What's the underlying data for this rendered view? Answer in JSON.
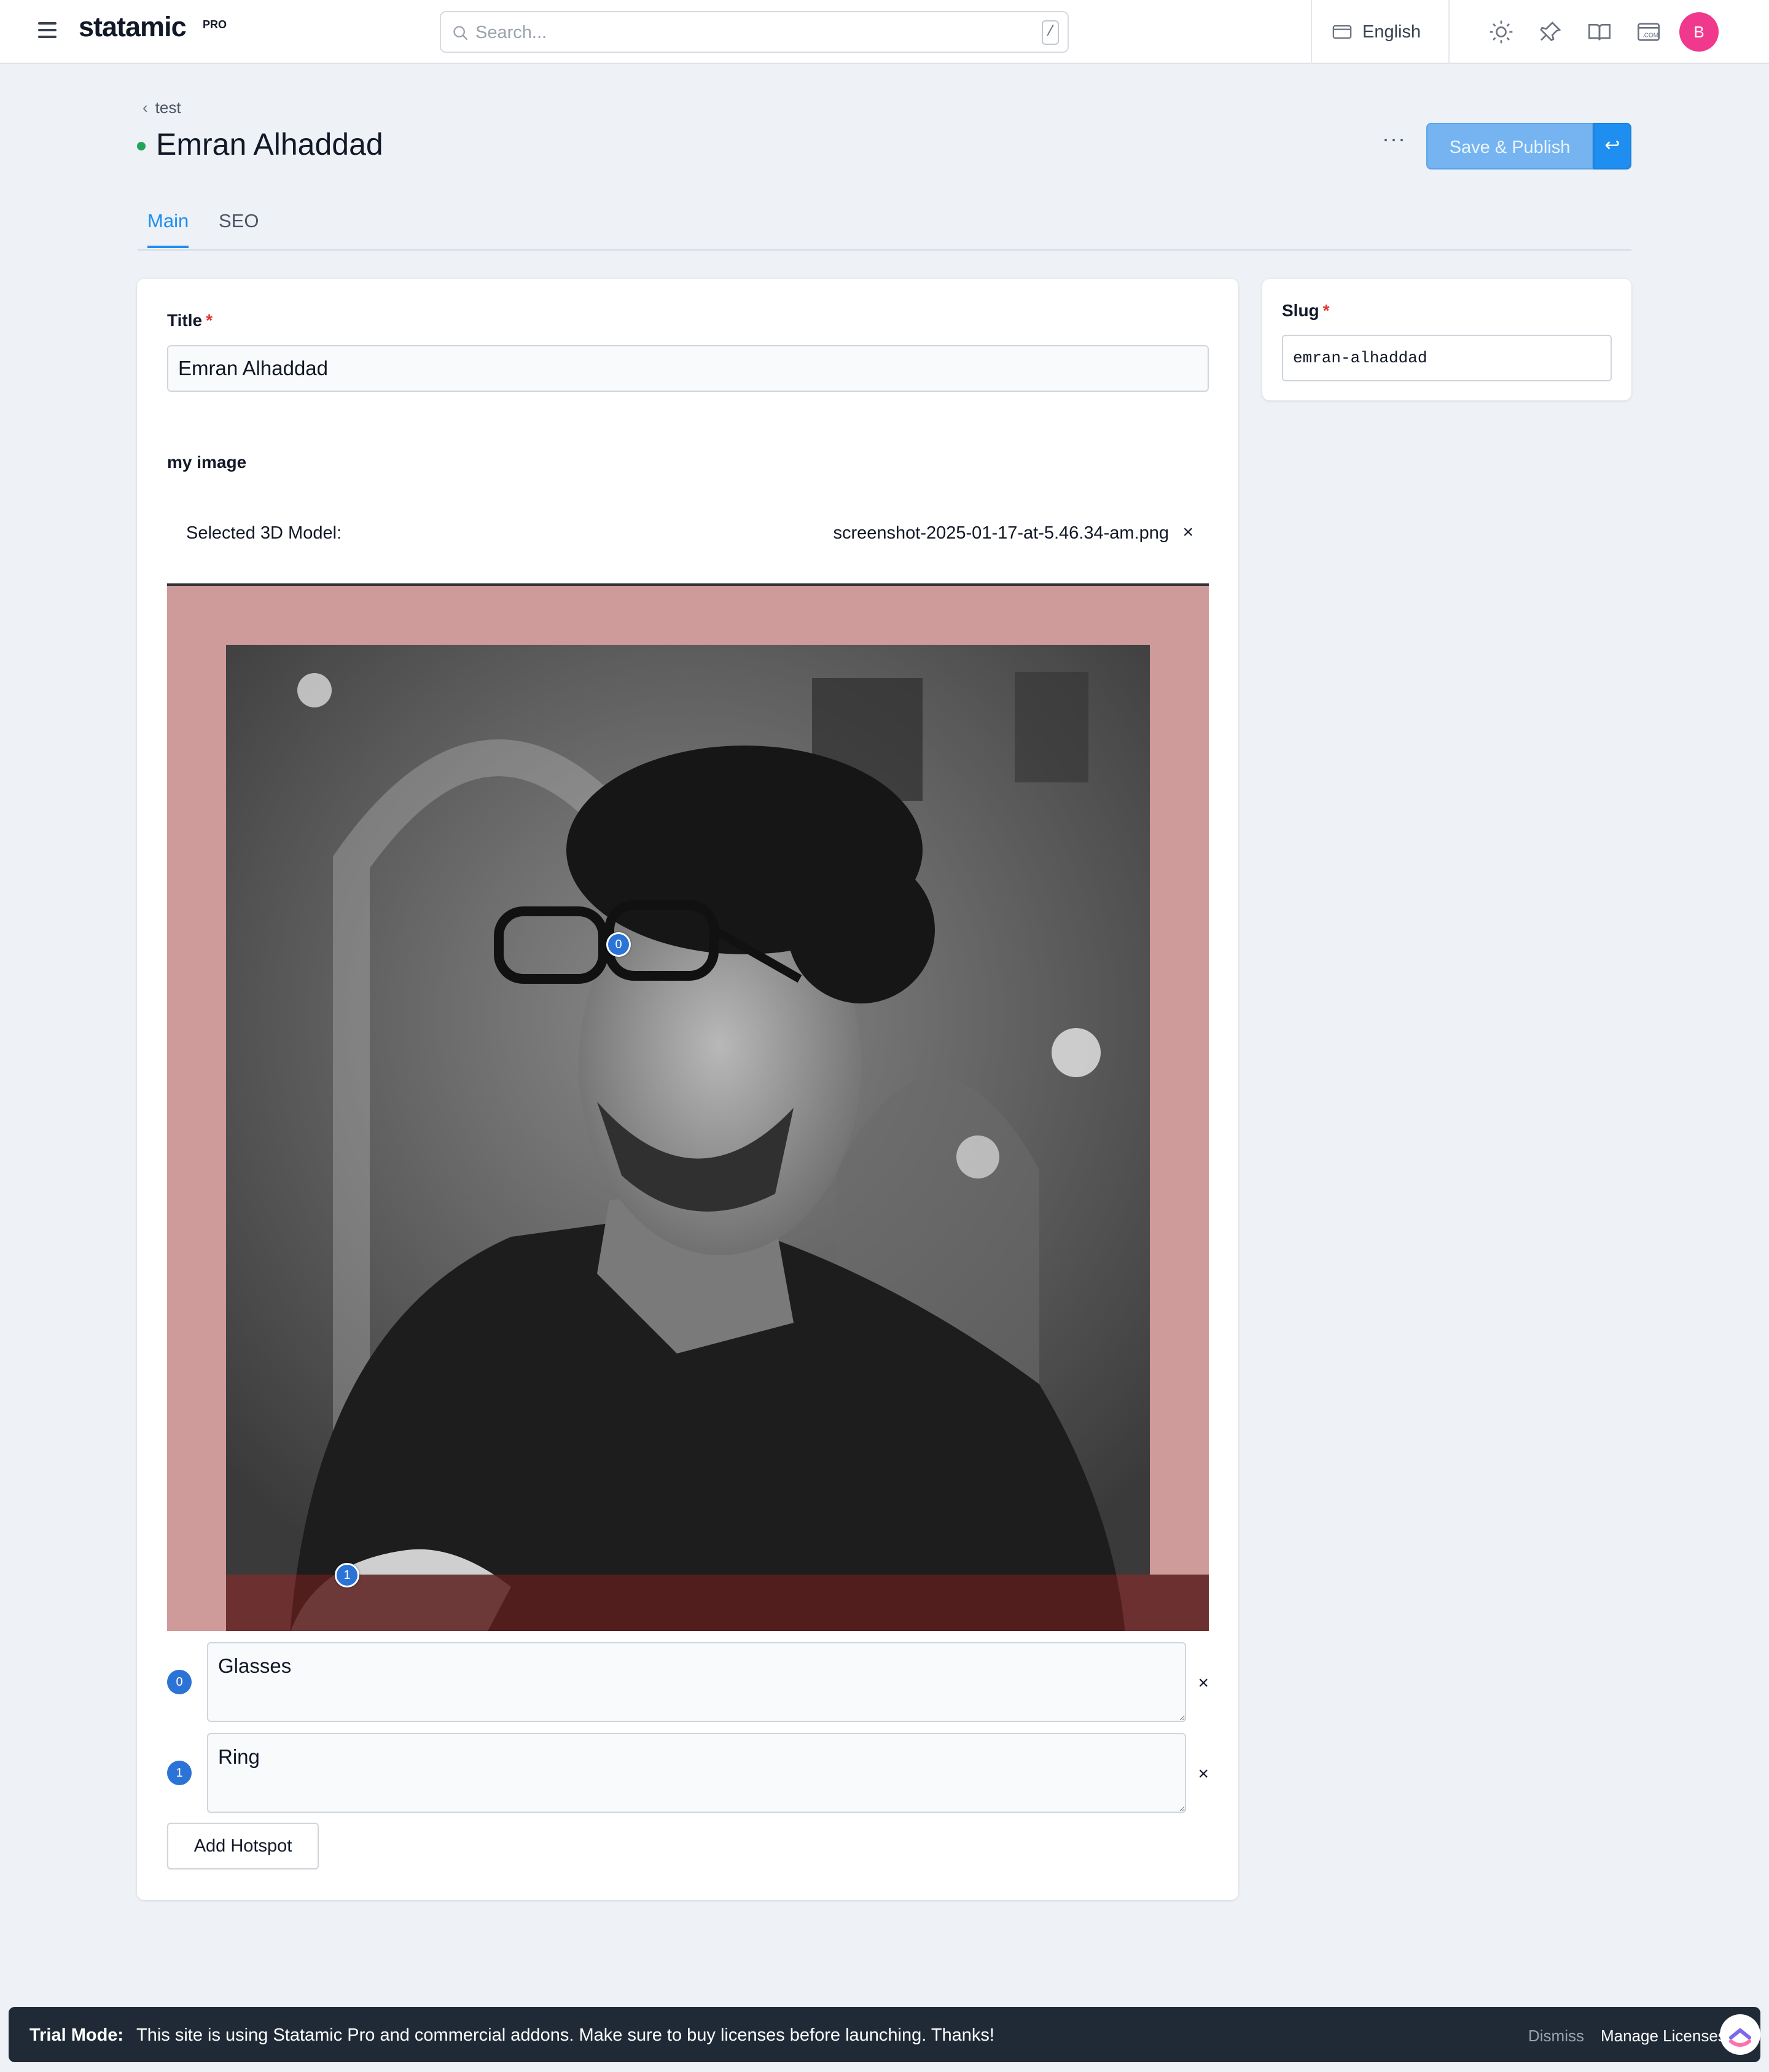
{
  "app": {
    "brand": "statamic",
    "brand_badge": "PRO"
  },
  "topnav": {
    "search_placeholder": "Search...",
    "search_shortcut": "/",
    "site": "English",
    "icons": [
      "menu-icon",
      "search-icon",
      "site-icon",
      "sun-icon",
      "pin-icon",
      "book-icon",
      "com-icon"
    ],
    "avatar_initial": "B",
    "avatar_color": "#f0388c"
  },
  "header": {
    "breadcrumb": "test",
    "title": "Emran Alhaddad",
    "status_color": "#22a55a",
    "more": "···",
    "publish_label": "Save & Publish",
    "publish_drop": "↩"
  },
  "tabs": [
    {
      "label": "Main",
      "active": true
    },
    {
      "label": "SEO",
      "active": false
    }
  ],
  "main": {
    "title_label": "Title",
    "required_mark": "*",
    "title_value": "Emran Alhaddad",
    "image_label": "my image",
    "model_label": "Selected 3D Model:",
    "model_file": "screenshot-2025-01-17-at-5.46.34-am.png",
    "remove": "×",
    "hotspots": [
      {
        "index": "0",
        "text": "Glasses"
      },
      {
        "index": "1",
        "text": "Ring"
      }
    ],
    "add_hotspot": "Add Hotspot"
  },
  "sidebar": {
    "slug_label": "Slug",
    "slug_value": "emran-alhaddad"
  },
  "trial": {
    "mode": "Trial Mode:",
    "message": "This site is using Statamic Pro and commercial addons. Make sure to buy licenses before launching. Thanks!",
    "dismiss": "Dismiss",
    "manage": "Manage Licenses"
  },
  "colors": {
    "accent": "#1f8ef1",
    "hotspot": "#2b73d6",
    "trial_bg": "#1f2a36"
  }
}
